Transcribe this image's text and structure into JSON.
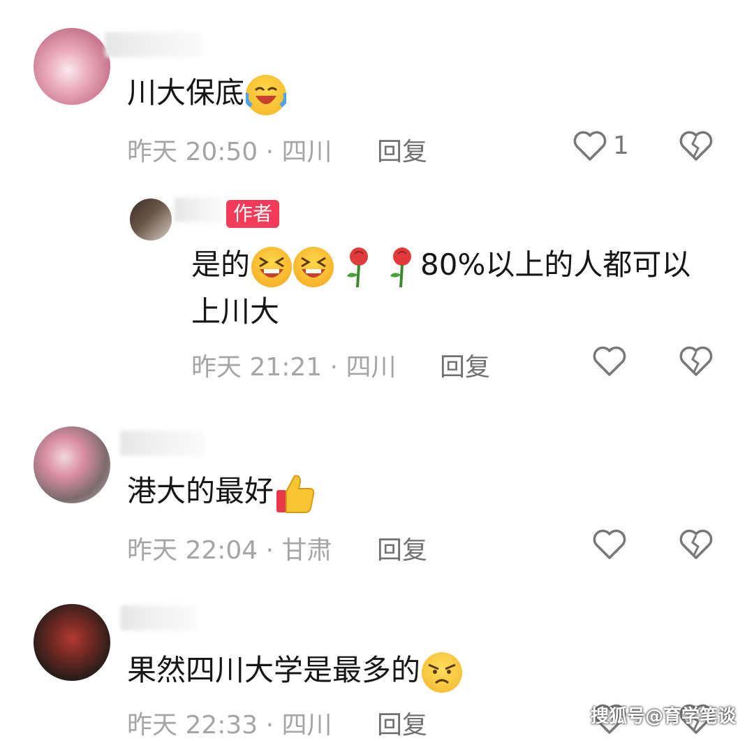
{
  "comments": [
    {
      "text": "川大保底",
      "emoji": "laugh-cry-emoji",
      "time": "昨天 20:50 · 四川",
      "reply_label": "回复",
      "likes": "1"
    },
    {
      "author_badge": "作者",
      "text": "是的",
      "text_after_emojis": "80%以上的人都可以上川大",
      "time": "昨天 21:21 · 四川",
      "reply_label": "回复"
    },
    {
      "text": "港大的最好",
      "emoji": "thumbs-up-emoji",
      "time": "昨天 22:04 · 甘肃",
      "reply_label": "回复"
    },
    {
      "text": "果然四川大学是最多的",
      "emoji": "angry-emoji",
      "time": "昨天 22:33 · 四川",
      "reply_label": "回复"
    }
  ],
  "watermark": "搜狐号@育学笔谈",
  "icons": {
    "like": "heart-outline-icon",
    "dislike": "broken-heart-icon"
  },
  "colors": {
    "badge": "#f23b58",
    "meta": "#a5a5a5",
    "text": "#161616"
  }
}
